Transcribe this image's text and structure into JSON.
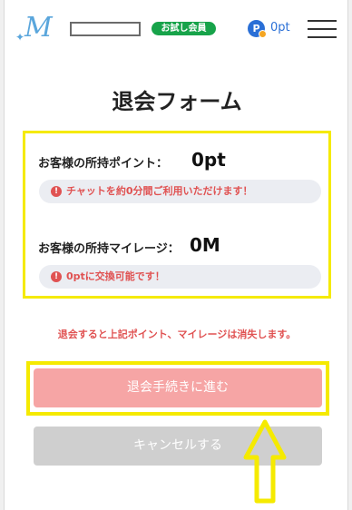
{
  "header": {
    "logo": "M",
    "logo_sparkle": "✦",
    "member_badge": "お試し会員",
    "points_icon": "P",
    "points": "0pt",
    "menu_icon": "hamburger-menu-icon"
  },
  "title": "退会フォーム",
  "points_row": {
    "label": "お客様の所持ポイント：",
    "value": "0pt",
    "notice": "チャットを約0分間ご利用いただけます！"
  },
  "mileage_row": {
    "label": "お客様の所持マイレージ：",
    "value": "0M",
    "notice": "0ptに交換可能です！"
  },
  "alert_icon": "!",
  "warning": "退会すると上記ポイント、マイレージは消失します。",
  "buttons": {
    "confirm": "退会手続きに進む",
    "cancel": "キャンセルする"
  },
  "colors": {
    "highlight": "#f5ea00",
    "danger_text": "#e05252",
    "confirm_bg": "#f6a5a5",
    "cancel_bg": "#cfcfcf",
    "badge_green": "#17a34a",
    "points_blue": "#2a6fd6"
  }
}
